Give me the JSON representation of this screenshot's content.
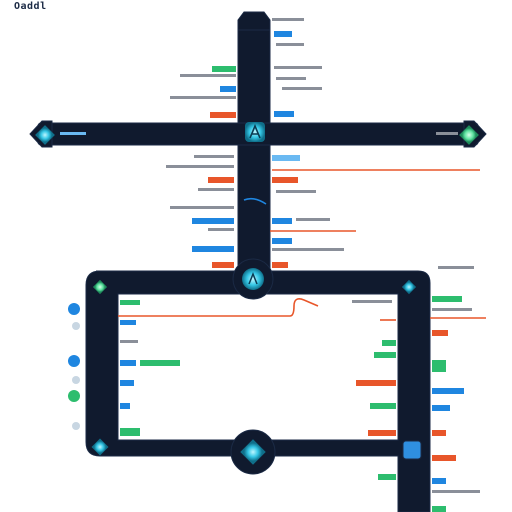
{
  "title": "Oaddl",
  "colors": {
    "track": "#101a2e",
    "track_edge": "#1b2a45",
    "node_cyan": "#35c7e6",
    "node_green": "#5fe3a1",
    "blue": "#1f86e0",
    "blue_light": "#6ab9f2",
    "green": "#2dbd6e",
    "orange": "#e8562a",
    "gray": "#8a8f99"
  },
  "node_icons": [
    "diamond-node",
    "diamond-node",
    "a-glyph-node",
    "a-glyph-node",
    "diamond-node",
    "diamond-node",
    "diamond-node",
    "diamond-node",
    "chip-node"
  ],
  "side_icons": [
    "blue-pin",
    "gray-pin",
    "blue-pin",
    "gray-pin",
    "green-pin",
    "gray-pin"
  ]
}
